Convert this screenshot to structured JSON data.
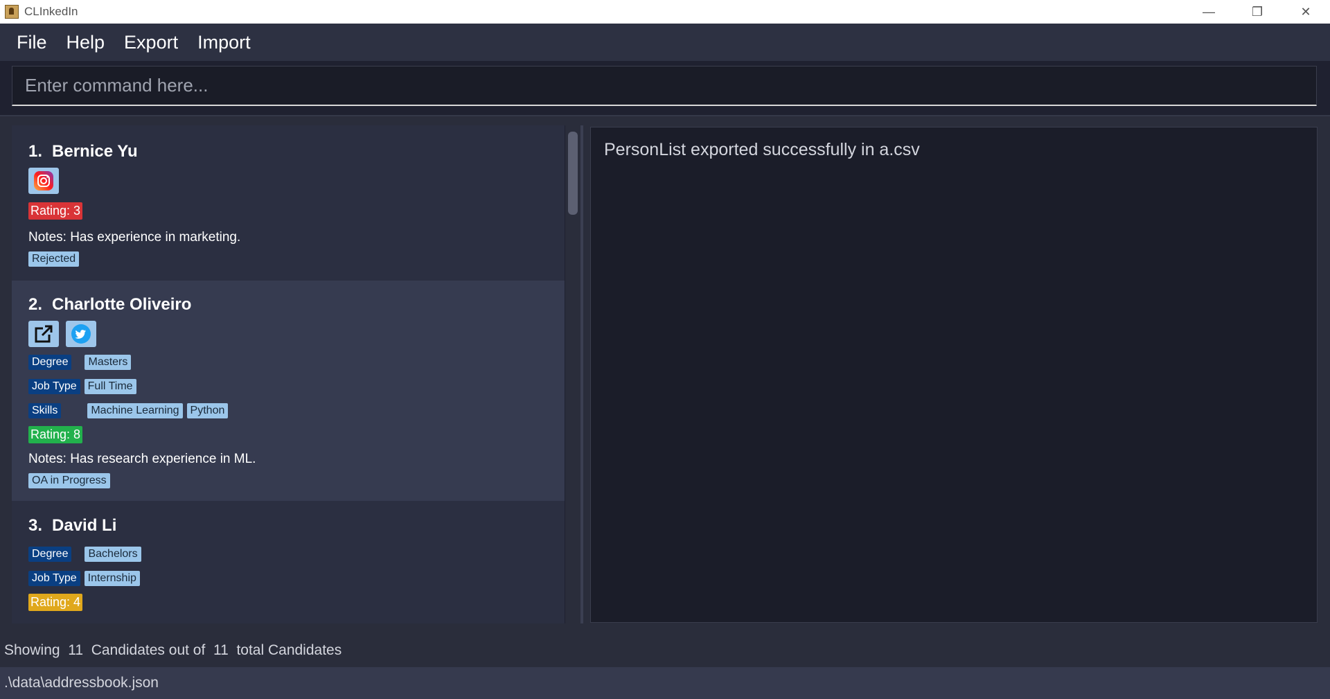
{
  "window": {
    "title": "CLInkedIn",
    "minimize": "—",
    "restore": "❐",
    "close": "✕"
  },
  "menu": [
    "File",
    "Help",
    "Export",
    "Import"
  ],
  "command": {
    "placeholder": "Enter command here..."
  },
  "candidates": [
    {
      "index": "1.",
      "name": "Bernice Yu",
      "rating": "Rating: 3",
      "rating_color": "#d93437",
      "notes": "Notes: Has experience in marketing.",
      "status": "Rejected"
    },
    {
      "index": "2.",
      "name": "Charlotte Oliveiro",
      "tags": [
        {
          "key": "Degree",
          "values": [
            "Masters"
          ]
        },
        {
          "key": "Job Type",
          "values": [
            "Full Time"
          ]
        },
        {
          "key": "Skills",
          "values": [
            "Machine Learning",
            "Python"
          ]
        }
      ],
      "rating": "Rating: 8",
      "rating_color": "#22b14c",
      "notes": "Notes: Has research experience in ML.",
      "status": "OA in Progress"
    },
    {
      "index": "3.",
      "name": "David Li",
      "tags": [
        {
          "key": "Degree",
          "values": [
            "Bachelors"
          ]
        },
        {
          "key": "Job Type",
          "values": [
            "Internship"
          ]
        }
      ],
      "rating": "Rating: 4",
      "rating_color": "#e0a81c"
    }
  ],
  "result": "PersonList exported successfully in a.csv",
  "status": {
    "summary": "Showing  11  Candidates out of  11  total Candidates",
    "file": ".\\data\\addressbook.json"
  }
}
